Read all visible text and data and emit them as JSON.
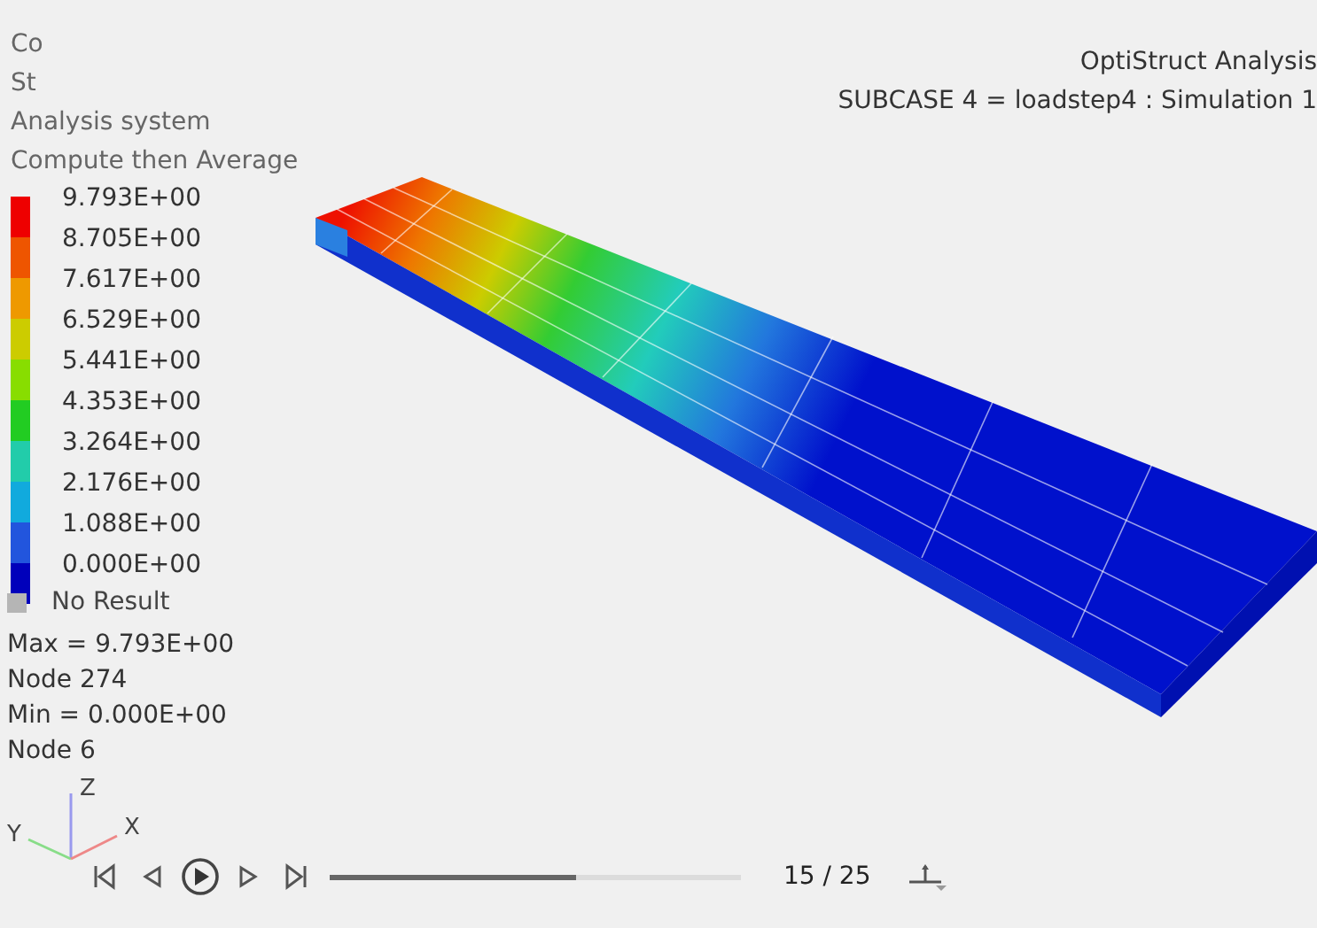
{
  "header_lines": [
    "Co",
    "St",
    "Analysis system",
    "Compute then Average"
  ],
  "legend": {
    "labels": [
      "9.793E+00",
      "8.705E+00",
      "7.617E+00",
      "6.529E+00",
      "5.441E+00",
      "4.353E+00",
      "3.264E+00",
      "2.176E+00",
      "1.088E+00",
      "0.000E+00"
    ],
    "bands": [
      {
        "color": "#ee0000"
      },
      {
        "color": "#ee5500"
      },
      {
        "color": "#ee9900"
      },
      {
        "color": "#cccc00"
      },
      {
        "color": "#88dd00"
      },
      {
        "color": "#22cc22"
      },
      {
        "color": "#22ccaa"
      },
      {
        "color": "#11aadd"
      },
      {
        "color": "#2255dd"
      },
      {
        "color": "#0000bb"
      }
    ],
    "no_result": "No Result"
  },
  "stats": [
    "Max =  9.793E+00",
    "Node 274",
    "Min = 0.000E+00",
    "Node 6"
  ],
  "axes": {
    "z": "Z",
    "y": "Y",
    "x": "X"
  },
  "title": [
    "OptiStruct Analysis",
    "SUBCASE 4 = loadstep4  : Simulation 1"
  ],
  "player": {
    "level": 0.6,
    "frame": "15 / 25"
  }
}
